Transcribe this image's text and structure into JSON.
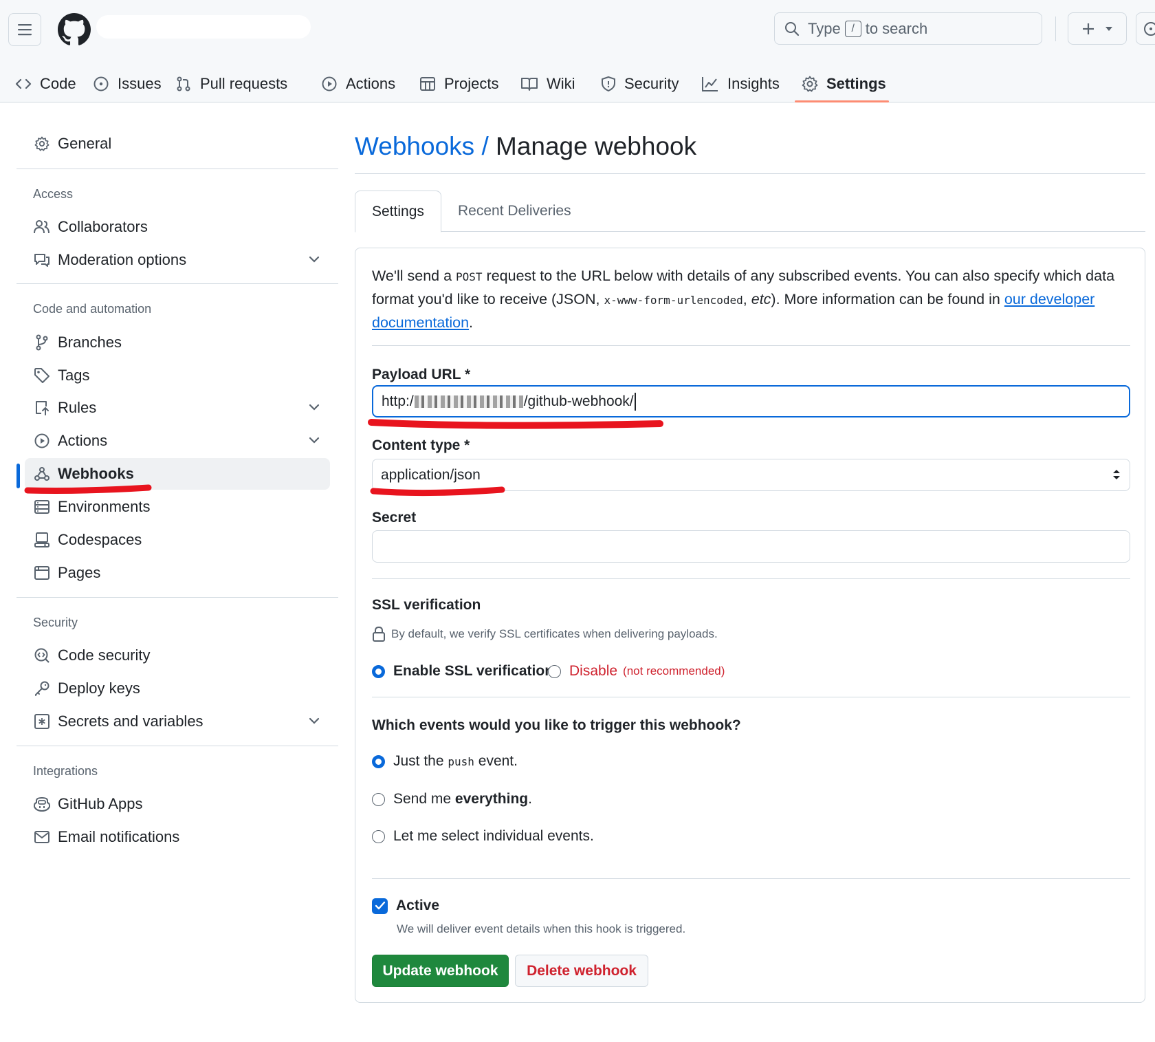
{
  "search": {
    "prefix": "Type",
    "key": "/",
    "suffix": "to search"
  },
  "repo_tabs": [
    {
      "label": "Code",
      "icon": "code-icon"
    },
    {
      "label": "Issues",
      "icon": "issue-icon"
    },
    {
      "label": "Pull requests",
      "icon": "pull-request-icon"
    },
    {
      "label": "Actions",
      "icon": "play-icon"
    },
    {
      "label": "Projects",
      "icon": "table-icon"
    },
    {
      "label": "Wiki",
      "icon": "book-icon"
    },
    {
      "label": "Security",
      "icon": "shield-icon"
    },
    {
      "label": "Insights",
      "icon": "graph-icon"
    },
    {
      "label": "Settings",
      "icon": "gear-icon",
      "active": true
    }
  ],
  "sidebar": {
    "general": "General",
    "sections": {
      "access": "Access",
      "code_automation": "Code and automation",
      "security": "Security",
      "integrations": "Integrations"
    },
    "items": {
      "collaborators": "Collaborators",
      "moderation": "Moderation options",
      "branches": "Branches",
      "tags": "Tags",
      "rules": "Rules",
      "actions": "Actions",
      "webhooks": "Webhooks",
      "environments": "Environments",
      "codespaces": "Codespaces",
      "pages": "Pages",
      "code_security": "Code security",
      "deploy_keys": "Deploy keys",
      "secrets": "Secrets and variables",
      "github_apps": "GitHub Apps",
      "email_notifications": "Email notifications"
    }
  },
  "main": {
    "breadcrumb": "Webhooks",
    "separator": "/",
    "title": "Manage webhook",
    "tabs": {
      "settings": "Settings",
      "recent": "Recent Deliveries"
    },
    "intro": {
      "p1": "We'll send a ",
      "post": "POST",
      "p2": " request to the URL below with details of any subscribed events. You can also specify which data format you'd like to receive (JSON, ",
      "urlenc": "x-www-form-urlencoded",
      "p3": ", ",
      "etc": "etc",
      "p4": "). More information can be found in ",
      "link": "our developer documentation",
      "p5": "."
    },
    "payload": {
      "label": "Payload URL *",
      "prefix": "http:/",
      "suffix": "/github-webhook/"
    },
    "content_type": {
      "label": "Content type *",
      "value": "application/json"
    },
    "secret": {
      "label": "Secret",
      "value": ""
    },
    "ssl": {
      "label": "SSL verification",
      "note": "By default, we verify SSL certificates when delivering payloads.",
      "enable": "Enable SSL verification",
      "disable": "Disable",
      "disable_note": "(not recommended)"
    },
    "events": {
      "question": "Which events would you like to trigger this webhook?",
      "just_push_a": "Just the",
      "just_push_code": "push",
      "just_push_b": "event.",
      "everything_a": "Send me",
      "everything_b": "everything",
      "everything_c": ".",
      "individual": "Let me select individual events."
    },
    "active": {
      "label": "Active",
      "note": "We will deliver event details when this hook is triggered."
    },
    "buttons": {
      "update": "Update webhook",
      "delete": "Delete webhook"
    }
  },
  "colors": {
    "accent": "#0969da",
    "primary_button": "#1f883d",
    "danger": "#cf222e",
    "tab_underline": "#fd8c73",
    "annotation": "#e8141e"
  }
}
